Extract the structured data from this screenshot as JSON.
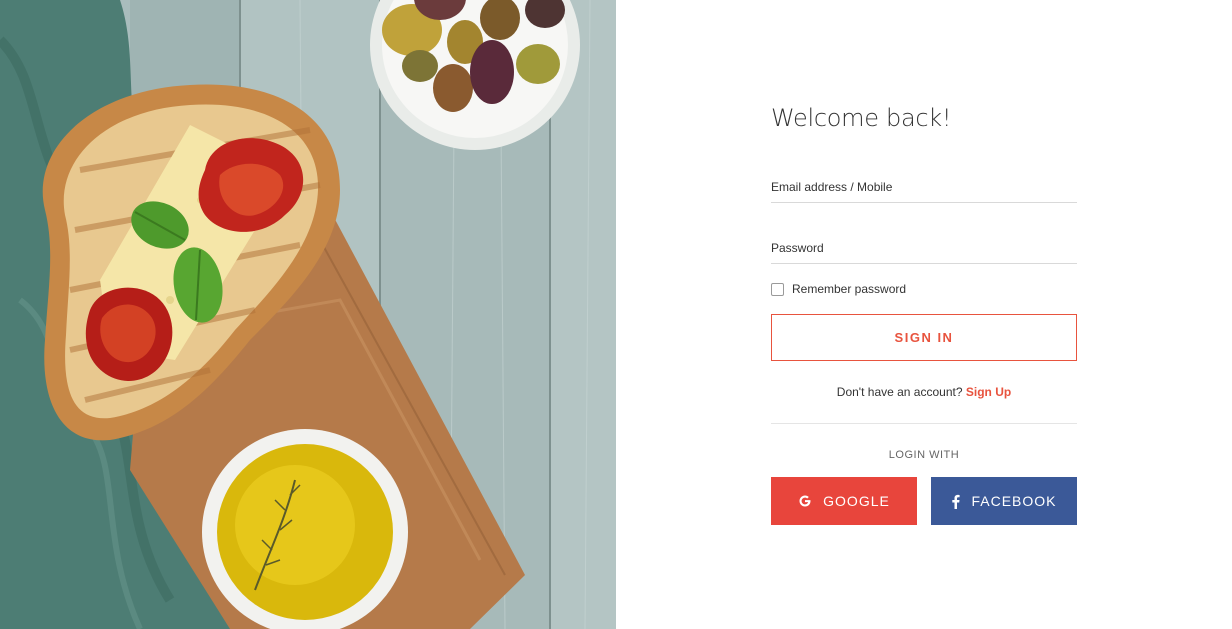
{
  "login": {
    "title": "Welcome back!",
    "email_placeholder": "Email address / Mobile",
    "password_placeholder": "Password",
    "remember_label": "Remember password",
    "sign_in_label": "SIGN IN",
    "signup_prompt": "Don't have an account?",
    "signup_link": "Sign Up",
    "login_with": "LOGIN WITH",
    "google_label": "GOOGLE",
    "facebook_label": "FACEBOOK"
  },
  "colors": {
    "accent": "#e8533e",
    "google": "#e8453c",
    "facebook": "#3b5998"
  },
  "hero": {
    "icon": "food-photo-bruschetta-olives-oil"
  }
}
